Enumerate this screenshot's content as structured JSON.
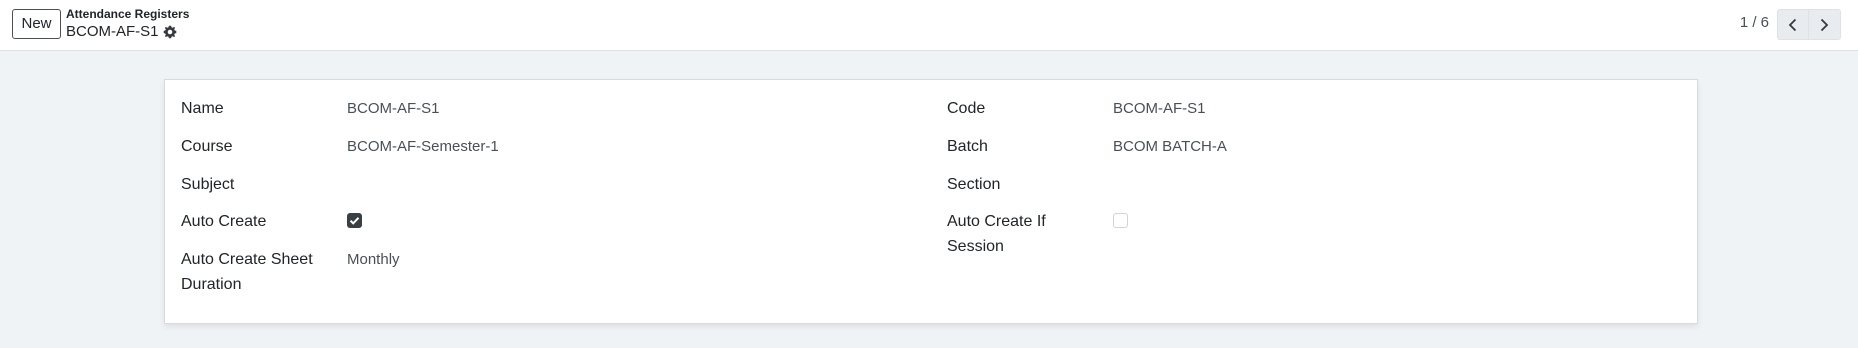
{
  "control_panel": {
    "new_button": "New",
    "breadcrumb_parent": "Attendance Registers",
    "breadcrumb_current": "BCOM-AF-S1",
    "pager": "1 / 6"
  },
  "form": {
    "left": {
      "name_label": "Name",
      "name_value": "BCOM-AF-S1",
      "course_label": "Course",
      "course_value": "BCOM-AF-Semester-1",
      "subject_label": "Subject",
      "auto_create_label": "Auto Create",
      "auto_create_checked": true,
      "sheet_duration_label_line1": "Auto Create Sheet",
      "sheet_duration_label_line2": "Duration",
      "sheet_duration_value": "Monthly"
    },
    "right": {
      "code_label": "Code",
      "code_value": "BCOM-AF-S1",
      "batch_label": "Batch",
      "batch_value": "BCOM BATCH-A",
      "section_label": "Section",
      "auto_create_session_label_line1": "Auto Create If",
      "auto_create_session_label_line2": "Session",
      "auto_create_session_checked": false
    }
  },
  "icons": {
    "gear": "gear-icon",
    "prev": "chevron-left-icon",
    "next": "chevron-right-icon",
    "check": "check-icon"
  },
  "colors": {
    "background": "#f0f3f6",
    "checkbox_on": "#3a3f44"
  }
}
